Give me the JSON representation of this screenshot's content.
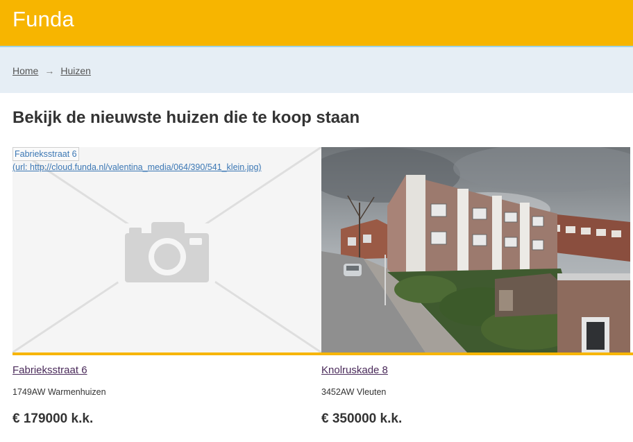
{
  "header": {
    "brand": "Funda",
    "brand_color": "#f7b500"
  },
  "breadcrumb": {
    "items": [
      "Home",
      "Huizen"
    ],
    "separator": "→"
  },
  "page_title": "Bekijk de nieuwste huizen die te koop staan",
  "listings": [
    {
      "image_alt": "Fabrieksstraat 6",
      "image_url_text": "(url: http://cloud.funda.nl/valentina_media/064/390/541_klein.jpg)",
      "title": "Fabrieksstraat 6",
      "address": "1749AW Warmenhuizen",
      "price": "€ 179000 k.k."
    },
    {
      "title": "Knolruskade 8",
      "address": "3452AW Vleuten",
      "price": "€ 350000 k.k."
    }
  ]
}
